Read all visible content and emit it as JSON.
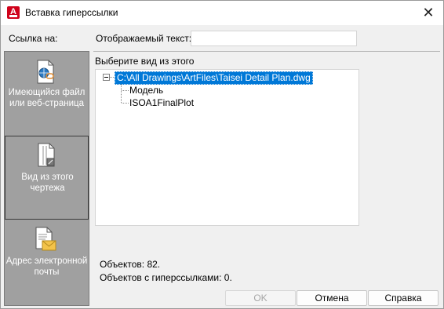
{
  "window": {
    "title": "Вставка гиперссылки",
    "app_icon": "autocad-icon",
    "close_icon": "close-icon"
  },
  "sidebar": {
    "label": "Ссылка на:",
    "items": [
      {
        "label": "Имеющийся файл или веб-страница",
        "icon": "file-web-icon",
        "selected": false
      },
      {
        "label": "Вид из этого чертежа",
        "icon": "drawing-view-icon",
        "selected": true
      },
      {
        "label": "Адрес электронной почты",
        "icon": "email-icon",
        "selected": false
      }
    ]
  },
  "display_text": {
    "label": "Отображаемый текст:",
    "value": ""
  },
  "view_select": {
    "label": "Выберите вид из этого",
    "tree": {
      "root": "C:\\All Drawings\\ArtFiles\\Taisei Detail Plan.dwg",
      "children": [
        "Модель",
        "ISOA1FinalPlot"
      ]
    }
  },
  "stats": {
    "objects": "Объектов: 82.",
    "hyperlinked": "Объектов с гиперссылками: 0."
  },
  "buttons": {
    "ok": "OK",
    "cancel": "Отмена",
    "help": "Справка"
  },
  "colors": {
    "selection": "#0078d7",
    "sidebar_bg": "#a0a0a0",
    "dialog_bg": "#f0f0f0",
    "brand": "#d0021b"
  }
}
